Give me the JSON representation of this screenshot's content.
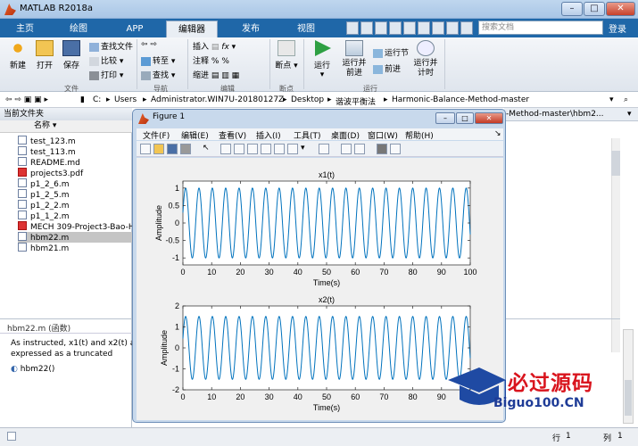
{
  "window": {
    "title": "MATLAB R2018a"
  },
  "tabs": [
    "主页",
    "绘图",
    "APP",
    "编辑器",
    "发布",
    "视图"
  ],
  "search": {
    "placeholder": "搜索文档"
  },
  "login": "登录",
  "ribbon": {
    "file_group": {
      "new": "新建",
      "open": "打开",
      "save": "保存",
      "find_files": "查找文件",
      "compare": "比较",
      "print": "打印",
      "label": "文件"
    },
    "nav_group": {
      "goto": "转至",
      "find": "查找",
      "label": "导航"
    },
    "edit_group": {
      "insert": "插入",
      "comment": "注释",
      "indent": "缩进",
      "label": "编辑"
    },
    "breakpoint_group": {
      "breakpoint": "断点",
      "label": "断点"
    },
    "run_group": {
      "run": "运行",
      "run_advance": "运行并前进",
      "run_section": "运行节",
      "advance": "前进",
      "run_time": "运行并计时",
      "label": "运行"
    }
  },
  "address": [
    "C:",
    "Users",
    "Administrator.WIN7U-20180127Z",
    "Desktop",
    "谐波平衡法",
    "Harmonic-Balance-Method-master"
  ],
  "file_panel": {
    "title": "当前文件夹",
    "column": "名称",
    "files": [
      "test_123.m",
      "test_113.m",
      "README.md",
      "projects3.pdf",
      "p1_2_6.m",
      "p1_2_5.m",
      "p1_2_2.m",
      "p1_1_2.m",
      "MECH 309-Project3-Bao-H...",
      "hbm22.m",
      "hbm21.m"
    ],
    "selected": "hbm22.m"
  },
  "details": {
    "header": "hbm22.m  (函数)",
    "text1": "As instructed, x1(t) and x2(t) are",
    "text2": "expressed as a truncated",
    "func": "hbm22()"
  },
  "editor_tab": "-Method-master\\hbm2...",
  "status": {
    "row_label": "行",
    "row": "1",
    "col_label": "列",
    "col": "1"
  },
  "figure": {
    "title": "Figure 1",
    "menu": [
      "文件(F)",
      "编辑(E)",
      "查看(V)",
      "插入(I)",
      "工具(T)",
      "桌面(D)",
      "窗口(W)",
      "帮助(H)"
    ]
  },
  "chart_data": [
    {
      "type": "line",
      "title": "x1(t)",
      "xlabel": "Time(s)",
      "ylabel": "Amplitude",
      "xlim": [
        0,
        100
      ],
      "ylim": [
        -1.2,
        1.2
      ],
      "xticks": [
        0,
        10,
        20,
        30,
        40,
        50,
        60,
        70,
        80,
        90,
        100
      ],
      "yticks": [
        -1,
        -0.5,
        0,
        0.5,
        1
      ],
      "ytick_labels": [
        "-1",
        "-0.5",
        "0",
        "0.5",
        "1"
      ],
      "series": [
        {
          "function": "sin",
          "amplitude": 1,
          "period": 4.65,
          "phase": 0.3,
          "color": "#0072bd"
        }
      ]
    },
    {
      "type": "line",
      "title": "x2(t)",
      "xlabel": "Time(s)",
      "ylabel": "Amplitude",
      "xlim": [
        0,
        100
      ],
      "ylim": [
        -2,
        2
      ],
      "xticks": [
        0,
        10,
        20,
        30,
        40,
        50,
        60,
        70,
        80,
        90,
        100
      ],
      "xtick_labels_visible": [
        "0",
        "10",
        "20",
        "30",
        "40",
        "50",
        "60",
        "70",
        "80",
        "90"
      ],
      "yticks": [
        -2,
        -1,
        0,
        1,
        2
      ],
      "ytick_labels": [
        "-2",
        "-1",
        "0",
        "1",
        "2"
      ],
      "series": [
        {
          "function": "sin",
          "amplitude": 1.5,
          "period": 4.65,
          "phase": 0.3,
          "color": "#0072bd"
        }
      ]
    }
  ],
  "watermark": {
    "text": "必过源码",
    "sub": "Biguo100.CN"
  }
}
